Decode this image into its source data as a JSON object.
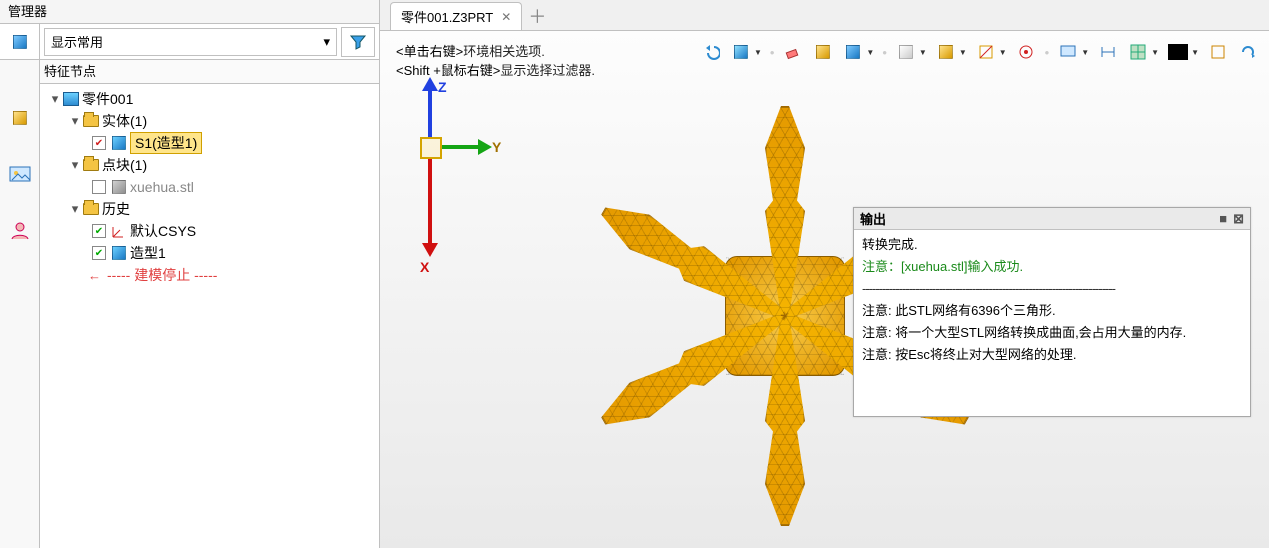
{
  "manager": {
    "title": "管理器",
    "display_combo": "显示常用",
    "feature_header": "特征节点"
  },
  "tree": {
    "root": "零件001",
    "solid_group": "实体(1)",
    "solid_item": "S1(造型1)",
    "block_group": "点块(1)",
    "block_item": "xuehua.stl",
    "history_group": "历史",
    "csys": "默认CSYS",
    "shape1": "造型1",
    "stop": "----- 建模停止 -----"
  },
  "tab": {
    "title": "零件001.Z3PRT"
  },
  "hints": {
    "line1_a": "<单击右键>",
    "line1_b": "环境相关选项.",
    "line2_a": "<Shift +鼠标右键>",
    "line2_b": "显示选择过滤器."
  },
  "axis": {
    "x": "X",
    "y": "Y",
    "z": "Z"
  },
  "output": {
    "title": "输出",
    "l1": "转换完成.",
    "l2": "注意：[xuehua.stl]输入成功.",
    "dash": "----------------------------------------------------------------------------",
    "l3": "注意: 此STL网络有6396个三角形.",
    "l4": "注意: 将一个大型STL网络转换成曲面,会占用大量的内存.",
    "l5": "注意: 按Esc将终止对大型网络的处理."
  }
}
